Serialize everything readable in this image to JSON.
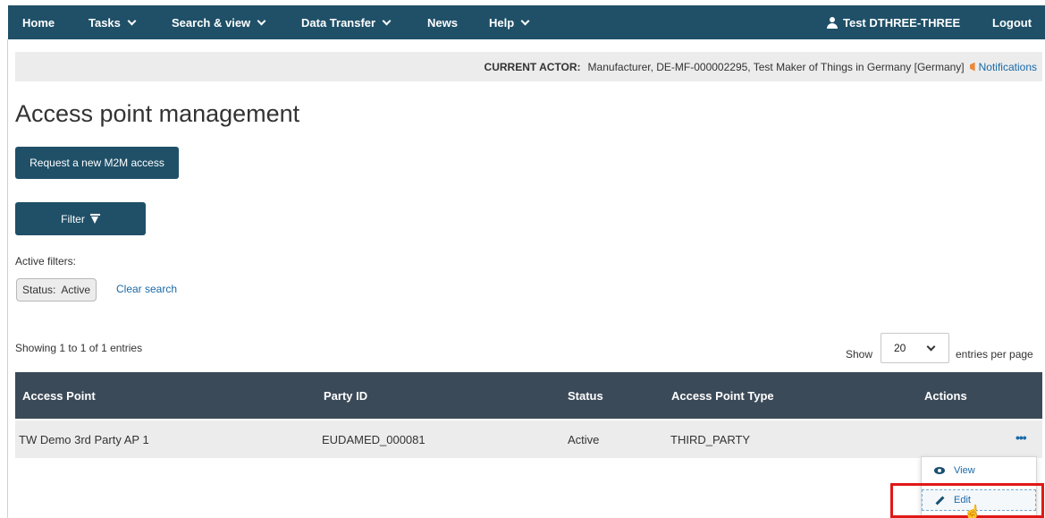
{
  "nav": {
    "home": "Home",
    "tasks": "Tasks",
    "search_view": "Search & view",
    "data_transfer": "Data Transfer",
    "news": "News",
    "help": "Help",
    "user": "Test DTHREE-THREE",
    "logout": "Logout"
  },
  "actor": {
    "label": "CURRENT ACTOR:",
    "value": "Manufacturer, DE-MF-000002295, Test Maker of Things in Germany [Germany]",
    "notifications": "Notifications"
  },
  "page": {
    "title": "Access point management",
    "request_button": "Request a new M2M access",
    "filter_button": "Filter"
  },
  "filters": {
    "active_label": "Active filters:",
    "chip_key": "Status:",
    "chip_value": "Active",
    "clear": "Clear search"
  },
  "list": {
    "showing": "Showing 1 to 1 of 1 entries",
    "show": "Show",
    "page_size": "20",
    "per_page": "entries per page"
  },
  "table": {
    "headers": [
      "Access Point",
      "Party ID",
      "Status",
      "Access Point Type",
      "Actions"
    ],
    "rows": [
      {
        "access_point": "TW Demo 3rd Party AP 1",
        "party_id": "EUDAMED_000081",
        "status": "Active",
        "type": "THIRD_PARTY",
        "actions": "•••"
      }
    ]
  },
  "menu": {
    "view": "View",
    "edit": "Edit"
  },
  "colors": {
    "nav_bg": "#1f5068",
    "table_header_bg": "#3b4a58",
    "link": "#1a6aa8",
    "highlight": "#e01818"
  }
}
